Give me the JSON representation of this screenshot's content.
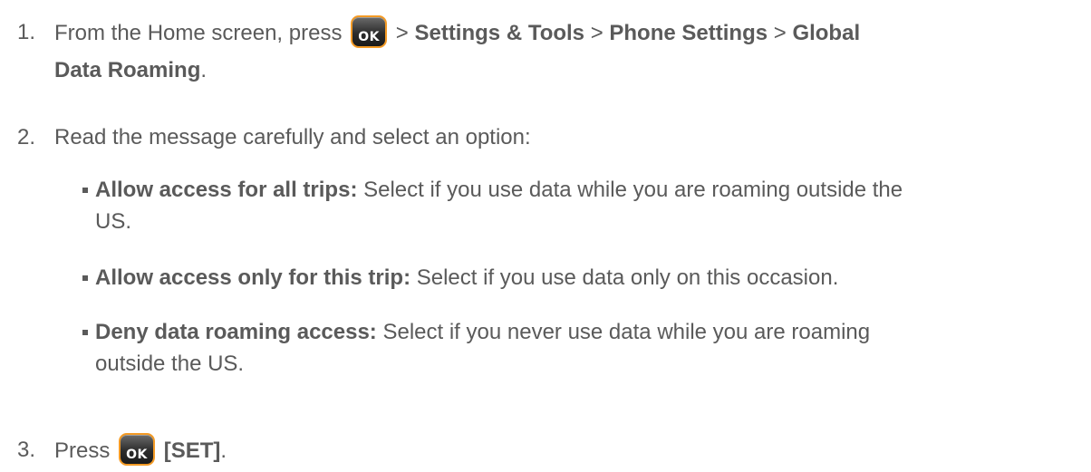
{
  "step1": {
    "number": "1.",
    "text_before": "From the Home screen, press",
    "sep1": " > ",
    "settings_tools": "Settings & Tools",
    "sep2": " > ",
    "phone_settings": "Phone Settings",
    "sep3": " > ",
    "global_data_roaming_1": "Global",
    "global_data_roaming_2": "Data Roaming",
    "end": "."
  },
  "step2": {
    "number": "2.",
    "text": "Read the message carefully and select an option:",
    "options": [
      {
        "label": "Allow access for all trips:",
        "description": " Select if you use data while you are roaming outside the",
        "description_2": "US."
      },
      {
        "label": "Allow access only for this trip:",
        "description": " Select if you use data only on this occasion."
      },
      {
        "label": "Deny data roaming access:",
        "description": " Select if you never use data while you are roaming",
        "description_2": "outside the US."
      }
    ]
  },
  "step3": {
    "number": "3.",
    "text_before": "Press",
    "set_label": "[SET]",
    "end": "."
  },
  "ok_button": {
    "label": "OK",
    "icon": "ok-key-icon",
    "accent": "#f39a25"
  }
}
